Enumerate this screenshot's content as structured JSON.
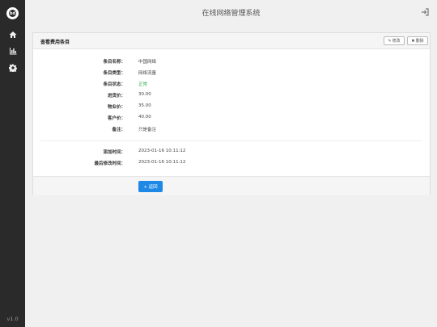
{
  "app": {
    "title": "在线网络管理系统",
    "version": "v1.0",
    "logo_text": "bd"
  },
  "sidebar": {
    "items": [
      {
        "name": "home",
        "icon": "home-icon"
      },
      {
        "name": "stats",
        "icon": "bar-chart-icon"
      },
      {
        "name": "settings",
        "icon": "gear-icon"
      }
    ]
  },
  "card": {
    "title": "查看费用条目",
    "edit_label": "修改",
    "delete_label": "删除",
    "fields": [
      {
        "label": "条目名称：",
        "value": "中国网络"
      },
      {
        "label": "条目类型：",
        "value": "网络流量"
      },
      {
        "label": "条目状态：",
        "value": "正常"
      },
      {
        "label": "进货价：",
        "value": "30.00"
      },
      {
        "label": "物业价：",
        "value": "35.00"
      },
      {
        "label": "客户价：",
        "value": "40.00"
      },
      {
        "label": "备注：",
        "value": "只是备注"
      }
    ],
    "times": [
      {
        "label": "添加时间：",
        "value": "2023-01-16 10:11:12"
      },
      {
        "label": "最后修改时间：",
        "value": "2023-01-16 10:11:12"
      }
    ],
    "back_label": "+ 返回"
  },
  "colors": {
    "sidebar_bg": "#2a2a2a",
    "status_ok": "#2eaa4a",
    "primary": "#1e88e5"
  }
}
